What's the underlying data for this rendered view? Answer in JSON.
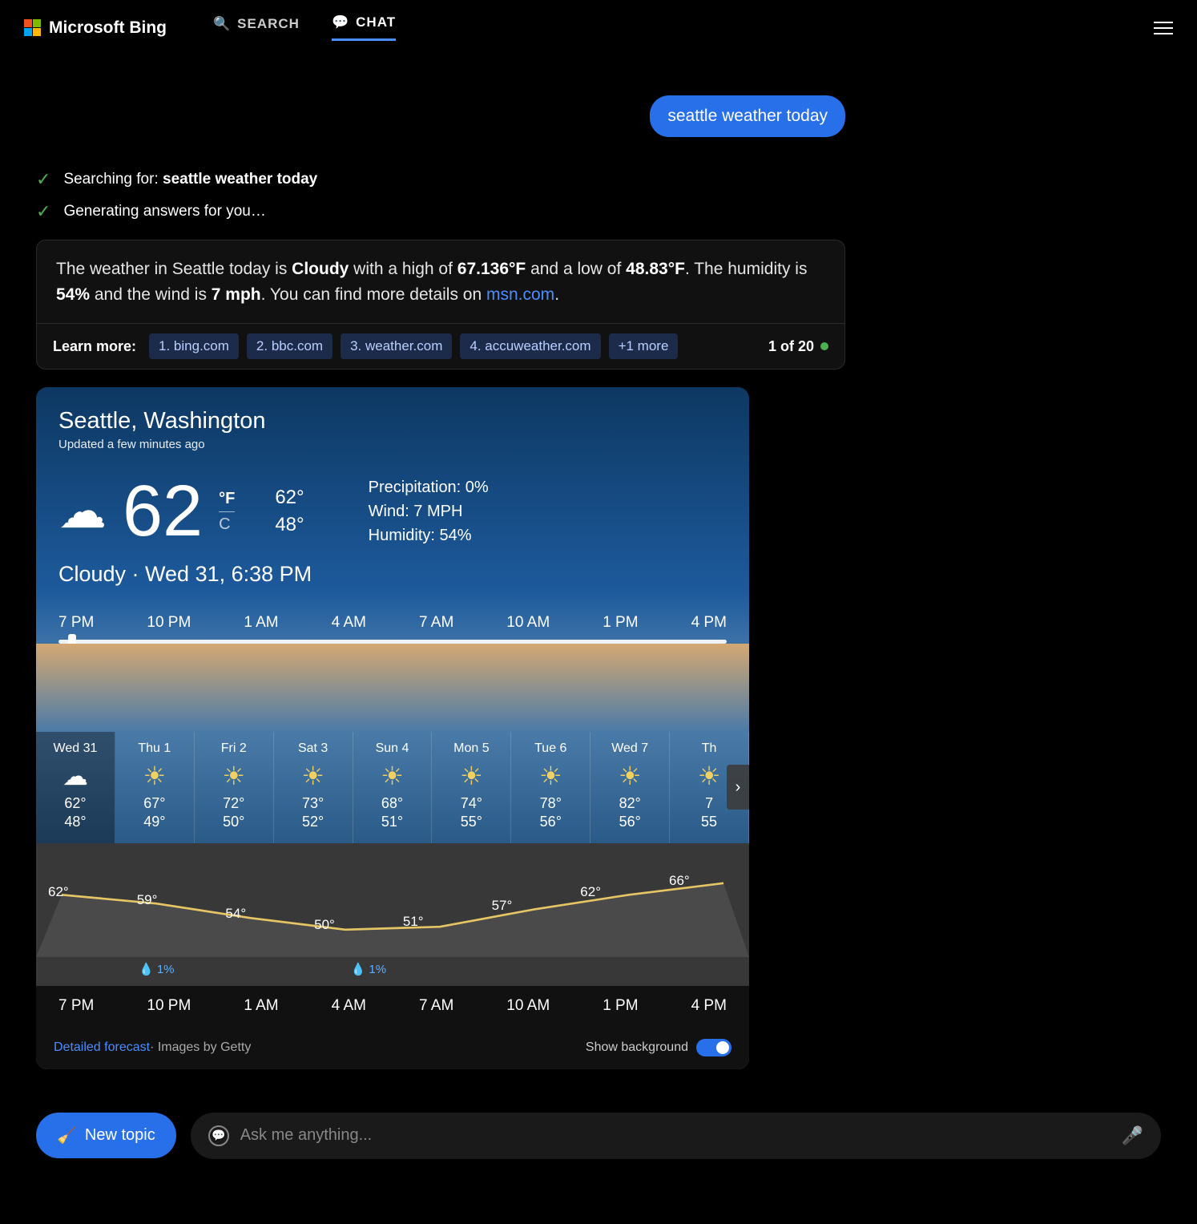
{
  "header": {
    "brand": "Microsoft Bing",
    "tabs": {
      "search": "SEARCH",
      "chat": "CHAT"
    }
  },
  "user_query": "seattle weather today",
  "status": {
    "searching_prefix": "Searching for: ",
    "searching_query": "seattle weather today",
    "generating": "Generating answers for you…"
  },
  "answer": {
    "p1": "The weather in Seattle today is ",
    "cond": "Cloudy",
    "p2": " with a high of ",
    "hi": "67.136°F",
    "p3": " and a low of ",
    "lo": "48.83°F",
    "p4": ". The humidity is ",
    "hum": "54%",
    "p5": " and the wind is ",
    "wind": "7 mph",
    "p6": ". You can find more details on ",
    "link": "msn.com",
    "p7": "."
  },
  "learn_more": {
    "label": "Learn more:",
    "sources": [
      "1. bing.com",
      "2. bbc.com",
      "3. weather.com",
      "4. accuweather.com",
      "+1 more"
    ],
    "pager": "1 of 20"
  },
  "weather": {
    "location": "Seattle, Washington",
    "updated": "Updated a few minutes ago",
    "temp": "62",
    "unit_f": "°F",
    "unit_c": "C",
    "hi": "62°",
    "lo": "48°",
    "precip": "Precipitation: 0%",
    "wind": "Wind: 7 MPH",
    "humidity": "Humidity: 54%",
    "condition_line": "Cloudy · Wed 31, 6:38 PM",
    "hours": [
      "7 PM",
      "10 PM",
      "1 AM",
      "4 AM",
      "7 AM",
      "10 AM",
      "1 PM",
      "4 PM"
    ],
    "daily": [
      {
        "name": "Wed 31",
        "hi": "62°",
        "lo": "48°",
        "icon": "cloud",
        "sel": true
      },
      {
        "name": "Thu 1",
        "hi": "67°",
        "lo": "49°",
        "icon": "sun"
      },
      {
        "name": "Fri 2",
        "hi": "72°",
        "lo": "50°",
        "icon": "sun"
      },
      {
        "name": "Sat 3",
        "hi": "73°",
        "lo": "52°",
        "icon": "sun"
      },
      {
        "name": "Sun 4",
        "hi": "68°",
        "lo": "51°",
        "icon": "sun"
      },
      {
        "name": "Mon 5",
        "hi": "74°",
        "lo": "55°",
        "icon": "sun"
      },
      {
        "name": "Tue 6",
        "hi": "78°",
        "lo": "56°",
        "icon": "sun"
      },
      {
        "name": "Wed 7",
        "hi": "82°",
        "lo": "56°",
        "icon": "sun"
      },
      {
        "name": "Th",
        "hi": "7",
        "lo": "55",
        "icon": "sun"
      }
    ],
    "precip_chips": [
      "💧 1%",
      "💧 1%"
    ],
    "detailed_link": "Detailed forecast",
    "images_credit": " · Images by Getty",
    "show_bg": "Show background"
  },
  "chart_data": {
    "type": "line",
    "title": "Hourly temperature",
    "xlabel": "",
    "ylabel": "°F",
    "categories": [
      "7 PM",
      "10 PM",
      "1 AM",
      "4 AM",
      "7 AM",
      "10 AM",
      "1 PM",
      "4 PM"
    ],
    "values": [
      62,
      59,
      54,
      50,
      51,
      57,
      62,
      66
    ],
    "ylim": [
      45,
      70
    ]
  },
  "input": {
    "new_topic": "New topic",
    "placeholder": "Ask me anything..."
  }
}
